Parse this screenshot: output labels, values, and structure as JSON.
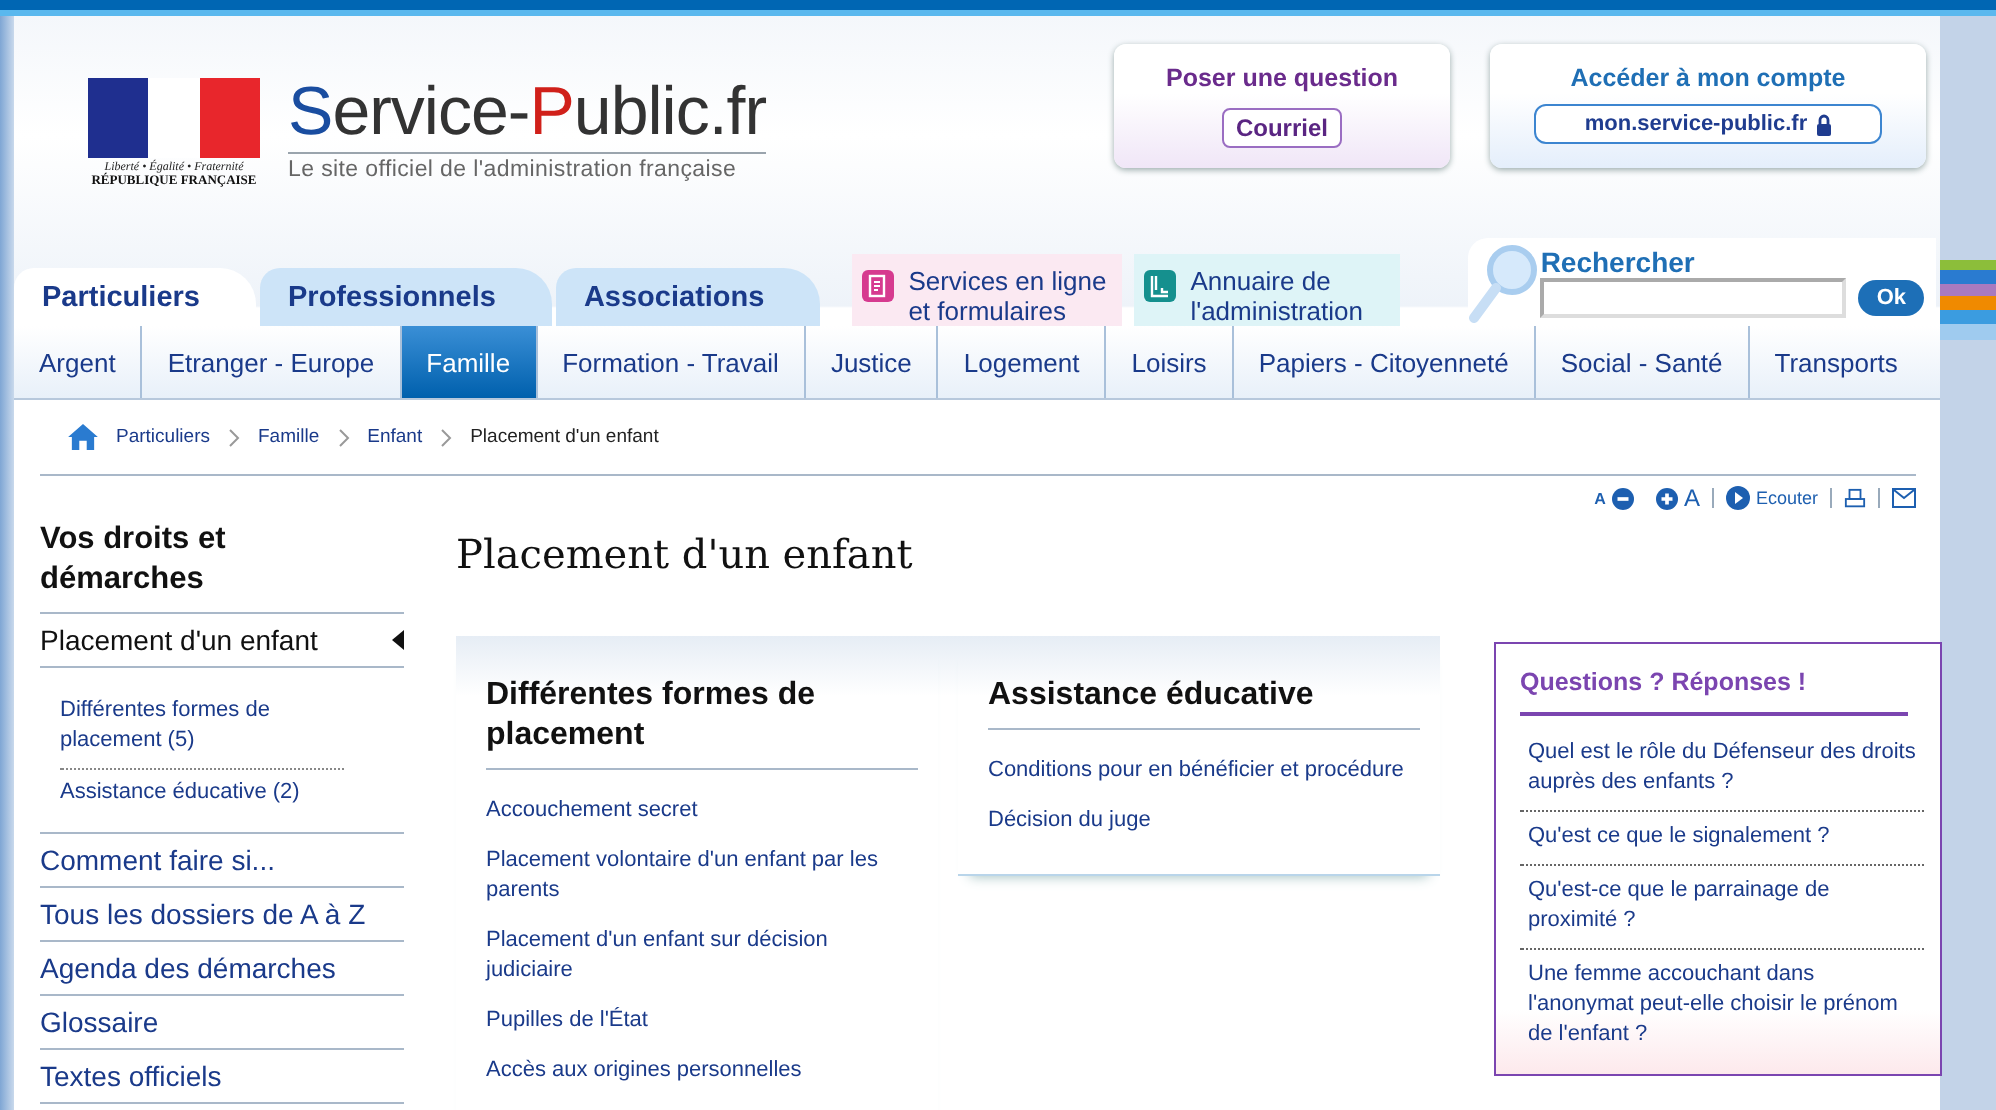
{
  "logo": {
    "motto": "Liberté • Égalité • Fraternité",
    "country": "RÉPUBLIQUE FRANÇAISE",
    "title_parts": [
      {
        "text": "S",
        "color": "#1a4da0"
      },
      {
        "text": "ervice-",
        "color": "#333333"
      },
      {
        "text": "P",
        "color": "#d0201a"
      },
      {
        "text": "ublic.fr",
        "color": "#333333"
      }
    ],
    "tagline": "Le site officiel de l'administration française"
  },
  "question_box": {
    "title": "Poser une question",
    "button": "Courriel"
  },
  "account_box": {
    "title": "Accéder à mon compte",
    "button": "mon.service-public.fr"
  },
  "audience_tabs": [
    {
      "label": "Particuliers",
      "selected": true
    },
    {
      "label": "Professionnels",
      "selected": false
    },
    {
      "label": "Associations",
      "selected": false
    }
  ],
  "quick_links": [
    {
      "kind": "services",
      "label": "Services en ligne et formulaires"
    },
    {
      "kind": "directory",
      "label": "Annuaire de l'administration"
    }
  ],
  "search": {
    "label": "Rechercher",
    "button": "Ok"
  },
  "nav": [
    {
      "label": "Argent",
      "selected": false
    },
    {
      "label": "Etranger - Europe",
      "selected": false
    },
    {
      "label": "Famille",
      "selected": true
    },
    {
      "label": "Formation - Travail",
      "selected": false
    },
    {
      "label": "Justice",
      "selected": false
    },
    {
      "label": "Logement",
      "selected": false
    },
    {
      "label": "Loisirs",
      "selected": false
    },
    {
      "label": "Papiers - Citoyenneté",
      "selected": false
    },
    {
      "label": "Social - Santé",
      "selected": false
    },
    {
      "label": "Transports",
      "selected": false
    }
  ],
  "breadcrumb": [
    "Particuliers",
    "Famille",
    "Enfant",
    "Placement d'un enfant"
  ],
  "tools": {
    "smaller": "A",
    "larger": "A",
    "listen": "Ecouter"
  },
  "sidebar": {
    "title": "Vos droits et démarches",
    "current": "Placement d'un enfant",
    "expanded": true,
    "sub_items": [
      "Différentes formes de placement (5)",
      "Assistance éducative (2)"
    ],
    "links": [
      "Comment faire si...",
      "Tous les dossiers de A à Z",
      "Agenda des démarches",
      "Glossaire",
      "Textes officiels"
    ]
  },
  "page_title": "Placement d'un enfant",
  "sections": [
    {
      "title": "Différentes formes de placement",
      "links": [
        "Accouchement secret",
        "Placement volontaire d'un enfant par les parents",
        "Placement d'un enfant sur décision judiciaire",
        "Pupilles de l'État",
        "Accès aux origines personnelles"
      ]
    },
    {
      "title": "Assistance éducative",
      "links": [
        "Conditions pour en bénéficier et procédure",
        "Décision du juge"
      ]
    }
  ],
  "faq": {
    "title": "Questions ? Réponses !",
    "items": [
      "Quel est le rôle du Défenseur des droits auprès des enfants ?",
      "Qu'est ce que le signalement ?",
      "Qu'est-ce que le parrainage de proximité ?",
      "Une femme accouchant dans l'anonymat peut-elle choisir le prénom de l'enfant ?"
    ]
  }
}
